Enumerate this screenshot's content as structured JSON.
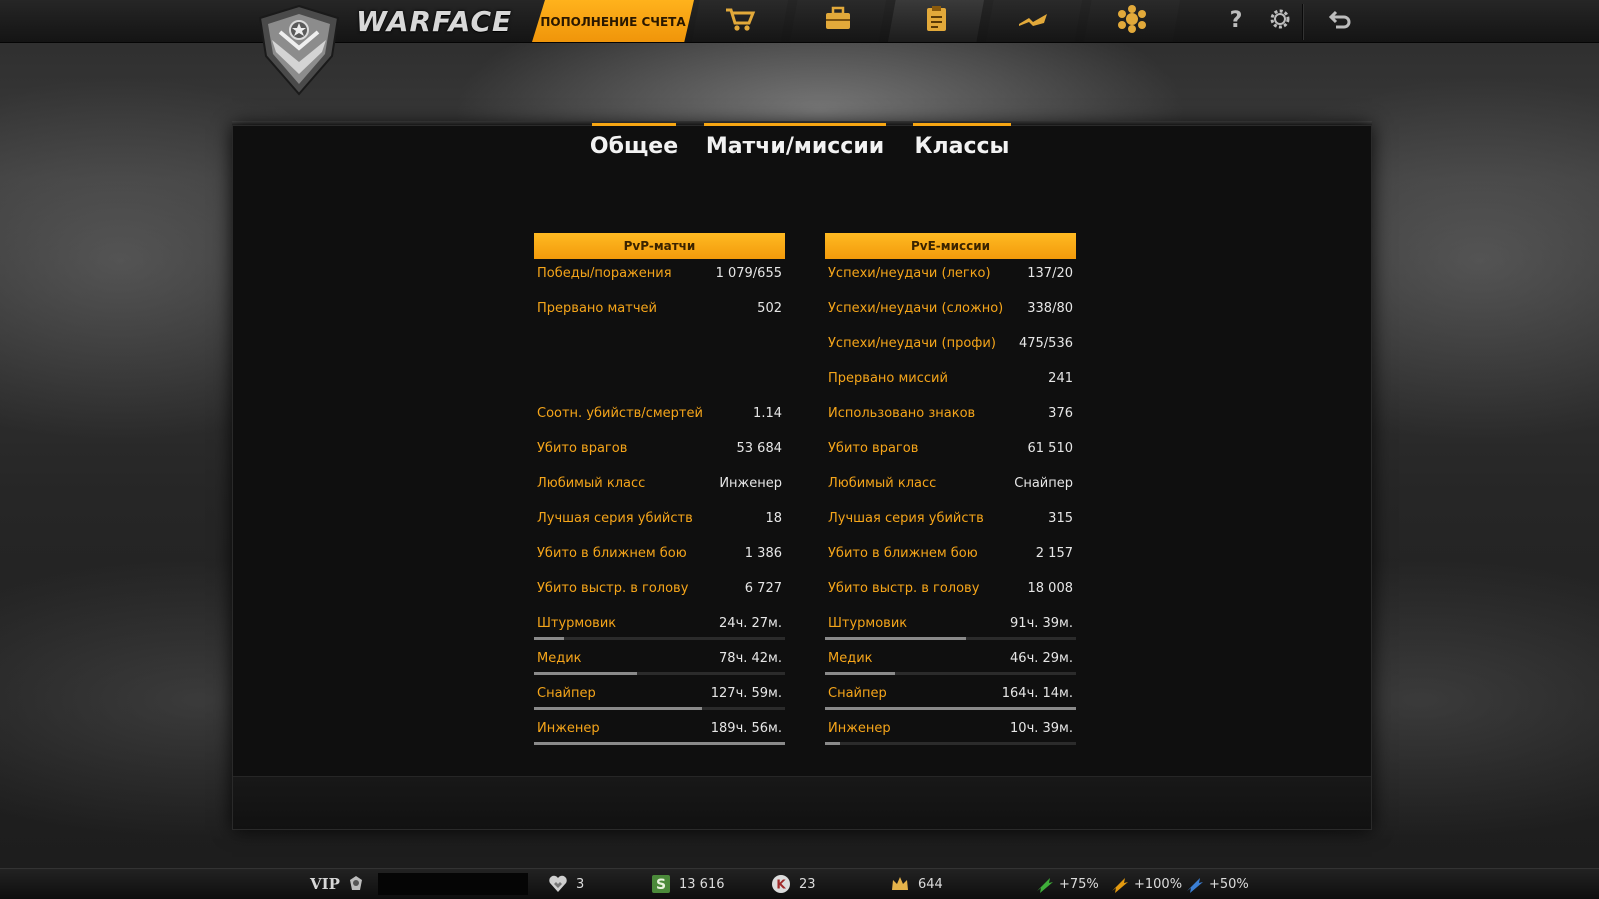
{
  "header": {
    "logo_text": "WARFACE",
    "topup_label": "ПОПОЛНЕНИЕ СЧЕТА",
    "nav_icons": [
      "cart-icon",
      "briefcase-icon",
      "clipboard-icon",
      "rank-wings-icon",
      "achievement-badge-icon"
    ],
    "util_icons": [
      "help-icon",
      "gear-icon",
      "back-arrow-icon"
    ]
  },
  "tabs": [
    {
      "label": "Общее",
      "active": false
    },
    {
      "label": "Матчи/миссии",
      "active": true
    },
    {
      "label": "Классы",
      "active": false
    }
  ],
  "pvp": {
    "title": "PvP-матчи",
    "rows_top": [
      {
        "label": "Победы/поражения",
        "value": "1 079/655"
      },
      {
        "label": "Прервано матчей",
        "value": "502"
      }
    ],
    "rows_mid": [
      {
        "label": "Соотн. убийств/смертей",
        "value": "1.14"
      },
      {
        "label": "Убито врагов",
        "value": "53 684"
      },
      {
        "label": "Любимый класс",
        "value": "Инженер"
      },
      {
        "label": "Лучшая серия убийств",
        "value": "18"
      },
      {
        "label": "Убито в ближнем бою",
        "value": "1 386"
      },
      {
        "label": "Убито выстр. в голову",
        "value": "6 727"
      }
    ],
    "classes": [
      {
        "label": "Штурмовик",
        "value": "24ч. 27м.",
        "share": 0.12
      },
      {
        "label": "Медик",
        "value": "78ч. 42м.",
        "share": 0.41
      },
      {
        "label": "Снайпер",
        "value": "127ч. 59м.",
        "share": 0.67
      },
      {
        "label": "Инженер",
        "value": "189ч. 56м.",
        "share": 1.0
      }
    ]
  },
  "pve": {
    "title": "PvE-миссии",
    "rows_top": [
      {
        "label": "Успехи/неудачи (легко)",
        "value": "137/20"
      },
      {
        "label": "Успехи/неудачи (сложно)",
        "value": "338/80"
      },
      {
        "label": "Успехи/неудачи (профи)",
        "value": "475/536"
      },
      {
        "label": "Прервано миссий",
        "value": "241"
      }
    ],
    "rows_mid": [
      {
        "label": "Использовано знаков",
        "value": "376"
      },
      {
        "label": "Убито врагов",
        "value": "61 510"
      },
      {
        "label": "Любимый класс",
        "value": "Снайпер"
      },
      {
        "label": "Лучшая серия убийств",
        "value": "315"
      },
      {
        "label": "Убито в ближнем бою",
        "value": "2 157"
      },
      {
        "label": "Убито выстр. в голову",
        "value": "18 008"
      }
    ],
    "classes": [
      {
        "label": "Штурмовик",
        "value": "91ч. 39м.",
        "share": 0.56
      },
      {
        "label": "Медик",
        "value": "46ч. 29м.",
        "share": 0.28
      },
      {
        "label": "Снайпер",
        "value": "164ч. 14м.",
        "share": 1.0
      },
      {
        "label": "Инженер",
        "value": "10ч. 39м.",
        "share": 0.06
      }
    ]
  },
  "footer": {
    "vip_label": "VIP",
    "rank_count": "3",
    "currency_s": "13 616",
    "currency_k": "23",
    "crowns": "644",
    "boost_xp": "+75%",
    "boost_money": "+100%",
    "boost_sp": "+50%",
    "colors": {
      "accent": "#f7a613",
      "boost_green": "#3fae3a",
      "boost_orange": "#e39a10",
      "boost_blue": "#3b7fd4"
    }
  }
}
